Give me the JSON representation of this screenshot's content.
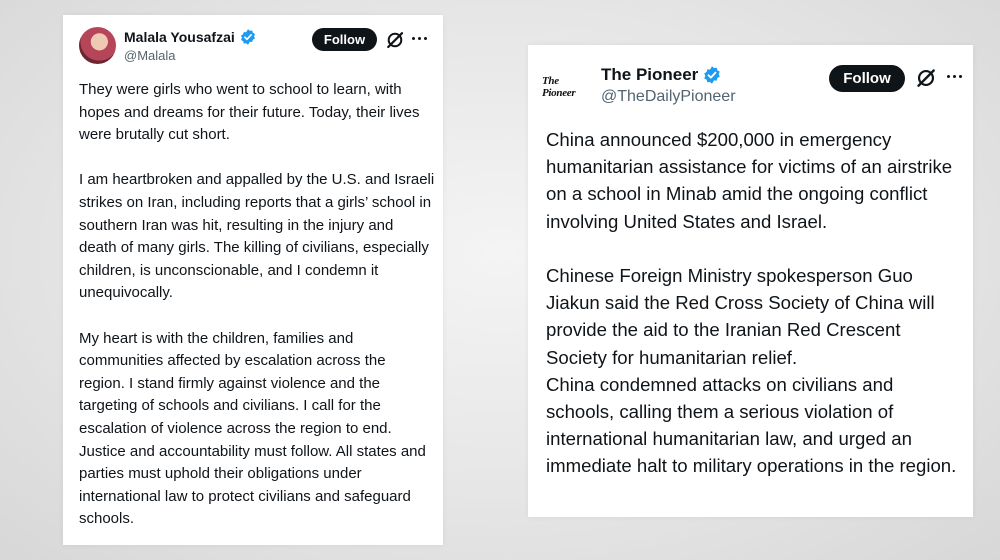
{
  "posts": [
    {
      "author": {
        "name": "Malala Yousafzai",
        "handle": "@Malala"
      },
      "follow_label": "Follow",
      "paragraphs": [
        "They were girls who went to school to learn, with hopes and dreams for their future. Today, their lives were brutally cut short.",
        "I am heartbroken and appalled by the U.S. and Israeli strikes on Iran, including reports that a girls’ school in southern Iran was hit, resulting in the injury and death of many girls. The killing of civilians, especially children, is unconscionable, and I condemn it unequivocally.",
        "My heart is with the children, families and communities affected by escalation across the region. I stand firmly against violence and the targeting of schools and civilians. I call for the escalation of violence across the region to end. Justice and accountability must follow. All states and parties must uphold their obligations under international law to protect civilians and safeguard schools."
      ]
    },
    {
      "author": {
        "name": "The Pioneer",
        "handle": "@TheDailyPioneer",
        "logo_text": "The Pioneer"
      },
      "follow_label": "Follow",
      "paragraphs": [
        "China announced $200,000 in emergency humanitarian assistance for victims of an airstrike on a school in Minab amid the ongoing conflict involving United States and Israel.",
        "Chinese Foreign Ministry spokesperson Guo Jiakun said the Red Cross Society of China will provide the aid to the Iranian Red Crescent Society for humanitarian relief.",
        "China condemned attacks on civilians and schools, calling them a serious violation of international humanitarian law, and urged an immediate halt to military operations in the region."
      ]
    }
  ],
  "colors": {
    "verified_badge": "#1d9bf0",
    "follow_button_bg": "#0f1419",
    "handle_text": "#536471"
  }
}
